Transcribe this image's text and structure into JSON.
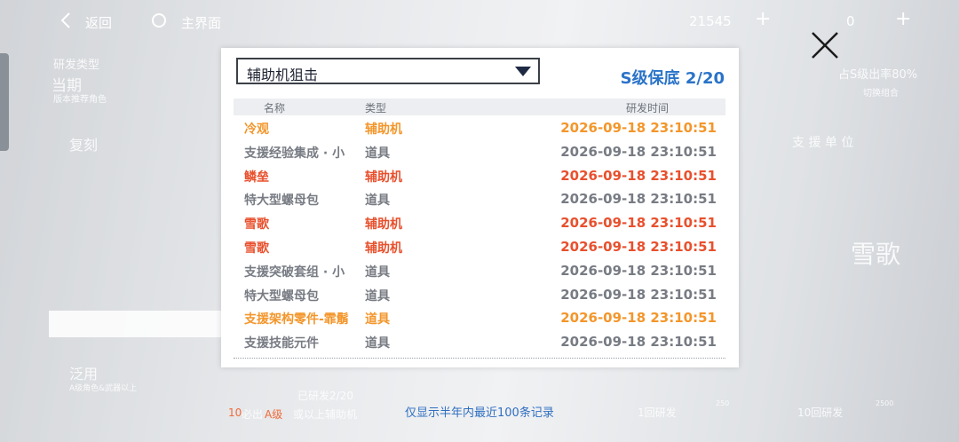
{
  "topbar": {
    "back_label": "返回",
    "home_label": "主界面",
    "currency_1": "21545",
    "currency_2": "0",
    "plus": "+"
  },
  "background": {
    "dev_type_label": "研发类型",
    "current_label": "当期",
    "current_sub": "版本推荐角色",
    "duplicate_label": "复刻",
    "general_label": "泛用",
    "general_sub": "A级角色&武器以上",
    "s_rate": "占S级出率80%",
    "switch_combo": "切换组合",
    "support_unit": "支 援 单 位",
    "hero_name": "雪歌",
    "pity_text": "已研发2/20",
    "ten_draw_note_1": "10",
    "ten_draw_note_2": "必出",
    "ten_draw_note_3": "A级",
    "ten_draw_note_4": "或以上辅助机",
    "one_draw": "1回研发",
    "ten_draw": "10回研发",
    "cost_1": "250",
    "cost_10": "2500"
  },
  "dialog": {
    "selected_pool": "辅助机狙击",
    "pity": "S级保底 2/20",
    "columns": [
      "名称",
      "类型",
      "研发时间"
    ],
    "rows": [
      {
        "name": "冷观",
        "type": "辅助机",
        "time": "2026-09-18 23:10:51",
        "tone": "orange"
      },
      {
        "name": "支援经验集成 · 小",
        "type": "道具",
        "time": "2026-09-18 23:10:51",
        "tone": "gray"
      },
      {
        "name": "鳞垒",
        "type": "辅助机",
        "time": "2026-09-18 23:10:51",
        "tone": "red"
      },
      {
        "name": "特大型螺母包",
        "type": "道具",
        "time": "2026-09-18 23:10:51",
        "tone": "gray"
      },
      {
        "name": "雪歌",
        "type": "辅助机",
        "time": "2026-09-18 23:10:51",
        "tone": "red"
      },
      {
        "name": "雪歌",
        "type": "辅助机",
        "time": "2026-09-18 23:10:51",
        "tone": "red"
      },
      {
        "name": "支援突破套组 · 小",
        "type": "道具",
        "time": "2026-09-18 23:10:51",
        "tone": "gray"
      },
      {
        "name": "特大型螺母包",
        "type": "道具",
        "time": "2026-09-18 23:10:51",
        "tone": "gray"
      },
      {
        "name": "支援架构零件-霏鬅",
        "type": "道具",
        "time": "2026-09-18 23:10:51",
        "tone": "orange"
      },
      {
        "name": "支援技能元件",
        "type": "道具",
        "time": "2026-09-18 23:10:51",
        "tone": "gray"
      }
    ],
    "footer_note": "仅显示半年内最近100条记录"
  },
  "colors": {
    "accent_blue": "#2a73c8",
    "rarity_s": "#e8502d",
    "rarity_a": "#f3962b",
    "normal": "#777b83"
  }
}
